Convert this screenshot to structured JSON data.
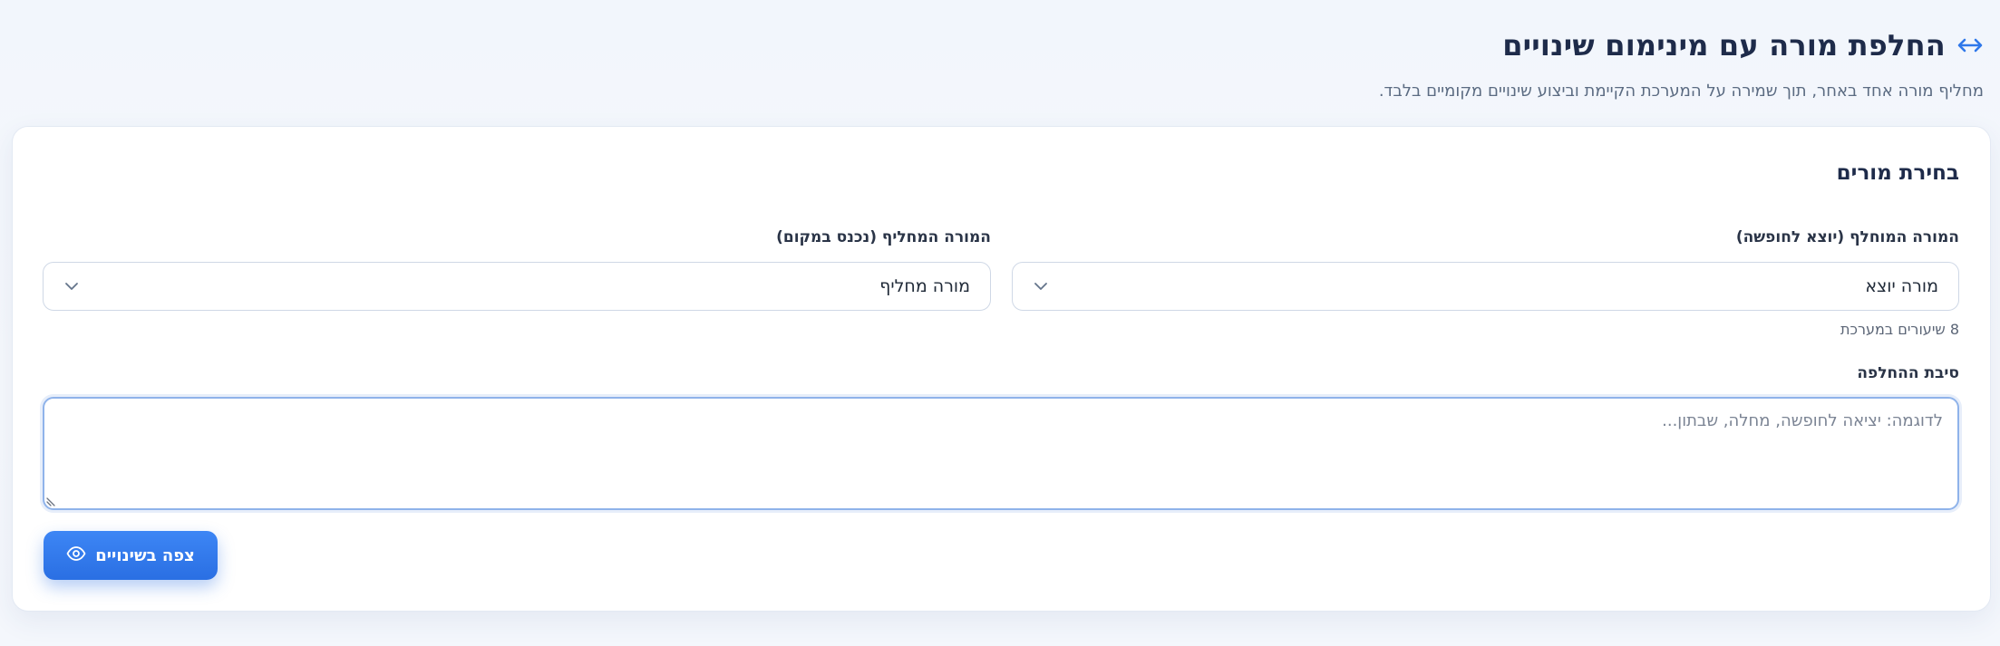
{
  "header": {
    "title": "החלפת מורה עם מינימום שינויים",
    "subtitle": "מחליף מורה אחד באחר, תוך שמירה על המערכת הקיימת וביצוע שינויים מקומיים בלבד.",
    "icon": "swap-arrows-icon"
  },
  "card": {
    "title": "בחירת מורים",
    "outgoing": {
      "label": "המורה המוחלף (יוצא לחופשה)",
      "value": "מורה יוצא",
      "helper": "8 שיעורים במערכת"
    },
    "incoming": {
      "label": "המורה המחליף (נכנס במקום)",
      "value": "מורה מחליף"
    },
    "reason": {
      "label": "סיבת ההחלפה",
      "placeholder": "לדוגמה: יציאה לחופשה, מחלה, שבתון...",
      "value": ""
    },
    "preview_button": {
      "label": "צפה בשינויים",
      "icon": "eye-icon"
    }
  },
  "colors": {
    "accent": "#2f78ea",
    "title": "#1e2b4a",
    "border": "#cfd8e6"
  }
}
